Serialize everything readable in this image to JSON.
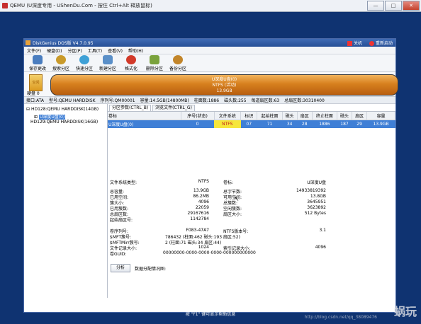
{
  "window": {
    "title": "QEMU (U深度专用 - UShenDu.Com - 按住 Ctrl+Alt 释放鼠标)",
    "buttons": [
      "—",
      "□",
      "✕"
    ]
  },
  "app": {
    "title": "DiskGenius DOS版 V4.7.0.95",
    "shutdown": "关机",
    "reboot": "重新启动"
  },
  "menu": [
    "文件(F)",
    "硬盘(D)",
    "分区(P)",
    "工具(T)",
    "查看(V)",
    "帮助(H)"
  ],
  "toolbar": [
    {
      "label": "保存更改",
      "icon": "save-icon",
      "color": "#4a7dbf"
    },
    {
      "label": "搜索分区",
      "icon": "search-icon",
      "color": "#c99a2b"
    },
    {
      "label": "快速分区",
      "icon": "quick-partition-icon",
      "color": "#3ea0d6"
    },
    {
      "label": "新建分区",
      "icon": "new-partition-icon",
      "color": "#5a8fc8"
    },
    {
      "label": "格式化",
      "icon": "format-icon",
      "color": "#d23a2a"
    },
    {
      "label": "删除分区",
      "icon": "delete-icon",
      "color": "#7aa23c"
    },
    {
      "label": "备份分区",
      "icon": "backup-icon",
      "color": "#c2852a"
    }
  ],
  "disk": {
    "label": "硬盘 0",
    "icon_text": "空闲",
    "bar_lines": [
      "U深度U盘(0)",
      "NTFS (活动)",
      "13.9GB"
    ]
  },
  "info": [
    "接口:ATA",
    "型号:QEMU HARDDISK",
    "序列号:QM00001",
    "容量:14.5GB(14800MB)",
    "柱面数:1886",
    "磁头数:255",
    "每道扇区数:63",
    "总扇区数:30310400"
  ],
  "tree": {
    "disk": "HD128:QEMU HARDDISK(14GB)",
    "partition": "U深度U盘(0)",
    "disk2": "HD129:QEMU HARDDISK(16GB)"
  },
  "tabs": [
    "分区参数(CTRL_B)",
    "浏览文件(CTRL_G)"
  ],
  "table": {
    "headers": [
      "卷标",
      "序号(状态)",
      "文件系统",
      "标识",
      "起始柱面",
      "磁头",
      "扇区",
      "终止柱面",
      "磁头",
      "扇区",
      "容量"
    ],
    "rows": [
      [
        "U深度U盘(0)",
        "0",
        "NTFS",
        "07",
        "71",
        "34",
        "28",
        "1886",
        "187",
        "29",
        "13.9GB"
      ]
    ]
  },
  "details": {
    "fs_type_label": "文件系统类型:",
    "fs_type": "NTFS",
    "vol_label_label": "卷标:",
    "vol_label": "U深度U盘",
    "left": [
      [
        "总容量:",
        "13.9GB"
      ],
      [
        "已用空间:",
        "86.2MB"
      ],
      [
        "簇大小:",
        "4096"
      ],
      [
        "已用簇数:",
        "22059"
      ],
      [
        "总扇区数:",
        "29167616"
      ],
      [
        "起始扇区号:",
        "1142784"
      ]
    ],
    "right": [
      [
        "总字节数:",
        "14933819392"
      ],
      [
        "可用空间:",
        "13.8GB"
      ],
      [
        "总簇数:",
        "3645951"
      ],
      [
        "空闲簇数:",
        "3623892"
      ],
      [
        "扇区大小:",
        "512 Bytes"
      ]
    ],
    "serial_label": "卷序列号:",
    "serial": "F083-47A7",
    "ntfs_ver_label": "NTFS版本号:",
    "ntfs_ver": "3.1",
    "mft_label": "$MFT簇号:",
    "mft": "786432 (柱面:462 磁头:193 扇区:52)",
    "mftmirr_label": "$MFTMirr簇号:",
    "mftmirr": "2 (柱面:71 磁头:34 扇区:44)",
    "rec_label": "文件记录大小:",
    "rec": "1024",
    "idx_label": "索引记录大小:",
    "idx": "4096",
    "guid_label": "卷GUID:",
    "guid": "00000000-0000-0000-0000-000000000000"
  },
  "analyze_button": "分析",
  "alloc_label": "数据分配情况图:",
  "statusbar": "按 \"F1\" 键可显示帮助信息",
  "watermark": {
    "text": "蜗玩",
    "url": "http://blog.csdn.net/qq_38089476"
  }
}
